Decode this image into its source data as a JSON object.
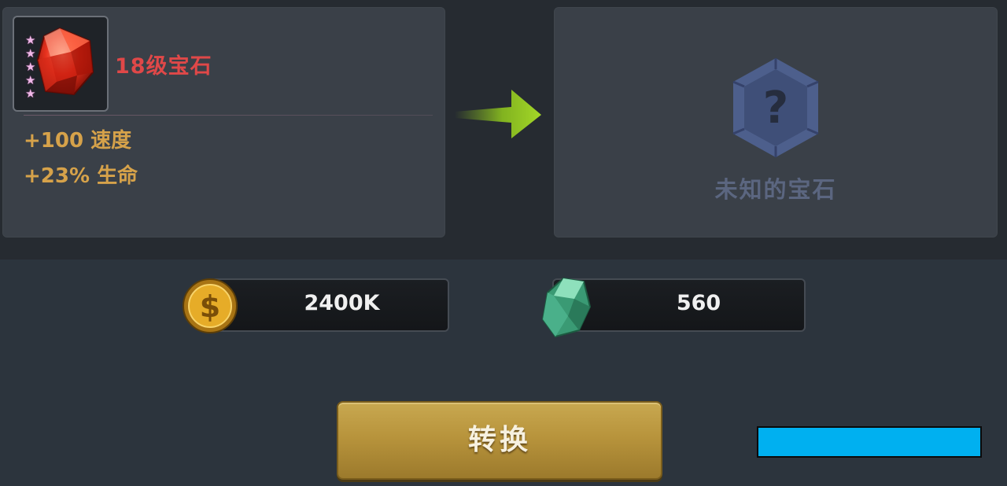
{
  "colors": {
    "background": "#2c343d",
    "panel": "#3a4048",
    "gem_title": "#e04848",
    "stat_text": "#d6a24a",
    "unknown_text": "#5b6680",
    "button_gold": "#b8943c",
    "overlay_blue": "#00b0f0"
  },
  "source_gem": {
    "icon": "red-gem-icon",
    "star_count": 5,
    "title": "18级宝石",
    "stats": [
      "+100 速度",
      "+23% 生命"
    ]
  },
  "arrow_icon": "green-arrow-right-icon",
  "target_gem": {
    "icon": "unknown-gem-question-icon",
    "label": "未知的宝石"
  },
  "costs": {
    "gold": {
      "icon": "gold-coin-icon",
      "value": "2400K"
    },
    "jade": {
      "icon": "jade-stone-icon",
      "value": "560"
    }
  },
  "convert_button": {
    "label": "转换"
  }
}
